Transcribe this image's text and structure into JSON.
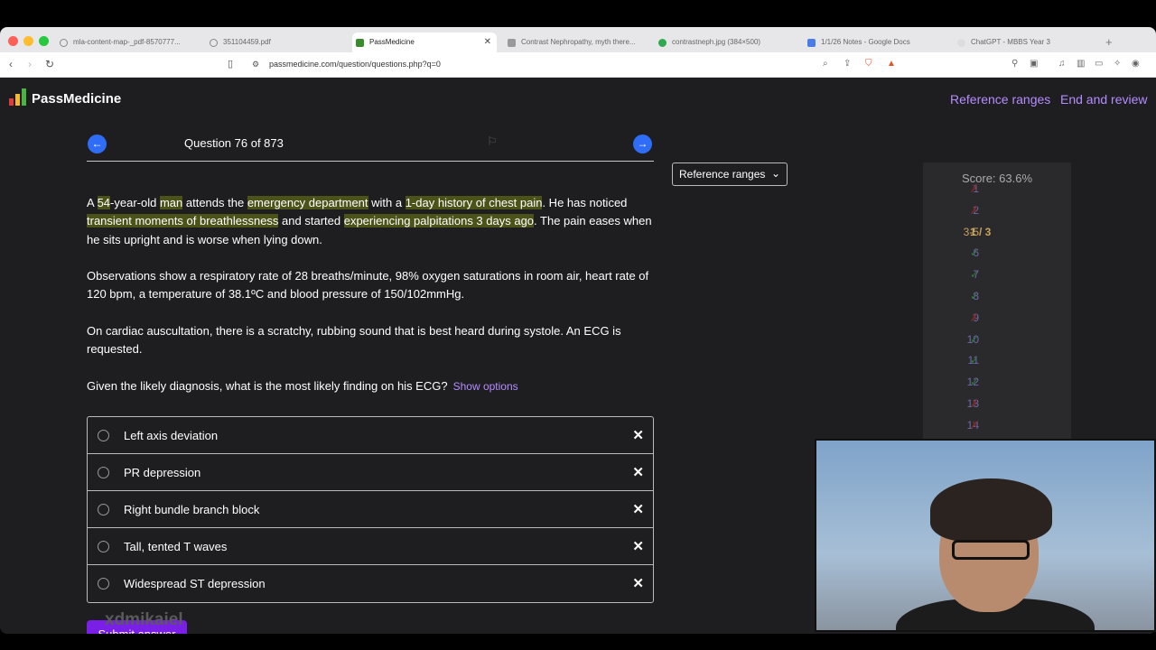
{
  "browser": {
    "tabs": [
      {
        "title": "mla-content-map-_pdf-8570777...",
        "favicon_color": "#888888",
        "active": false
      },
      {
        "title": "351104459.pdf",
        "favicon_color": "#888888",
        "active": false
      },
      {
        "title": "PassMedicine",
        "favicon_color": "#3b8b2e",
        "active": true
      },
      {
        "title": "Contrast Nephropathy, myth there...",
        "favicon_color": "#888888",
        "active": false
      },
      {
        "title": "contrastneph.jpg (384×500)",
        "favicon_color": "#2fa84f",
        "active": false
      },
      {
        "title": "1/1/26 Notes - Google Docs",
        "favicon_color": "#4a7ce8",
        "active": false
      },
      {
        "title": "ChatGPT - MBBS Year 3",
        "favicon_color": "#dddddd",
        "active": false
      }
    ],
    "url": "passmedicine.com/question/questions.php?q=0"
  },
  "header": {
    "logo_text": "PassMedicine",
    "reference_ranges_link": "Reference ranges",
    "end_review_link": "End and review"
  },
  "question": {
    "counter": "Question 76 of 873",
    "reference_ranges_button": "Reference ranges",
    "paragraph1": {
      "a": "A ",
      "h1": "54",
      "b": "-year-old ",
      "h2": "man",
      "c": " attends the ",
      "h3": "emergency department",
      "d": " with a ",
      "h4": "1-day history of chest pain",
      "e": ". He has noticed ",
      "h5": "transient moments of breathlessness",
      "f": " and started ",
      "h6": "experiencing palpitations 3 days ago",
      "g": ". The pain eases when he sits upright and is worse when lying down."
    },
    "paragraph2": "Observations show a respiratory rate of 28 breaths/minute, 98% oxygen saturations in room air, heart rate of 120 bpm, a temperature of 38.1ºC and blood pressure of 150/102mmHg.",
    "paragraph3": "On cardiac auscultation, there is a scratchy, rubbing sound that is best heard during systole. An ECG is requested.",
    "prompt": "Given the likely diagnosis, what is the most likely finding on his ECG?",
    "show_options": "Show options",
    "options": [
      "Left axis deviation",
      "PR depression",
      "Right bundle branch block",
      "Tall, tented T waves",
      "Widespread ST depression"
    ],
    "submit_label": "Submit answer"
  },
  "score": {
    "title": "Score: 63.6%",
    "rows": [
      {
        "num": "1",
        "mark": "✗",
        "status": "wrong"
      },
      {
        "num": "2",
        "mark": "✗",
        "status": "wrong"
      },
      {
        "num": "3-5",
        "mark": "1 / 3",
        "status": "partial"
      },
      {
        "num": "6",
        "mark": "✓",
        "status": "correct"
      },
      {
        "num": "7",
        "mark": "✓",
        "status": "correct"
      },
      {
        "num": "8",
        "mark": "✓",
        "status": "correct"
      },
      {
        "num": "9",
        "mark": "✗",
        "status": "wrong"
      },
      {
        "num": "10",
        "mark": "✓",
        "status": "correct"
      },
      {
        "num": "11",
        "mark": "✓",
        "status": "correct"
      },
      {
        "num": "12",
        "mark": "✓",
        "status": "correct"
      },
      {
        "num": "13",
        "mark": "✗",
        "status": "wrong"
      },
      {
        "num": "14",
        "mark": "✗",
        "status": "wrong"
      }
    ],
    "colors": {
      "wrong": "#7a2b2b",
      "partial": "#c9a35a",
      "correct": "#2f7a36"
    }
  },
  "webcam": {
    "label": "xdmikaiel"
  }
}
